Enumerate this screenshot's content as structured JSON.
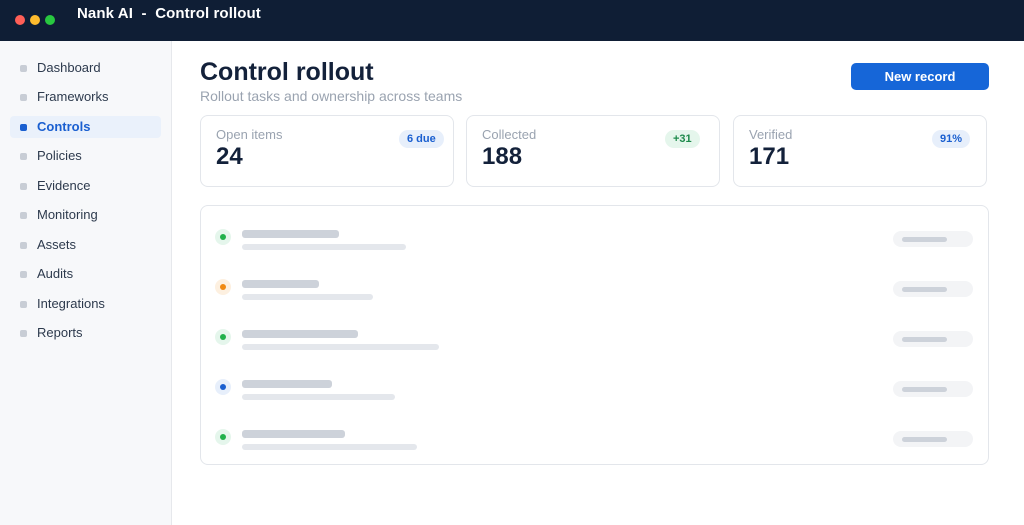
{
  "window": {
    "app_name": "Nank AI",
    "separator": "-",
    "page_name": "Control rollout"
  },
  "sidebar": {
    "items": [
      {
        "label": "Dashboard",
        "active": false
      },
      {
        "label": "Frameworks",
        "active": false
      },
      {
        "label": "Controls",
        "active": true
      },
      {
        "label": "Policies",
        "active": false
      },
      {
        "label": "Evidence",
        "active": false
      },
      {
        "label": "Monitoring",
        "active": false
      },
      {
        "label": "Assets",
        "active": false
      },
      {
        "label": "Audits",
        "active": false
      },
      {
        "label": "Integrations",
        "active": false
      },
      {
        "label": "Reports",
        "active": false
      }
    ]
  },
  "header": {
    "title": "Control rollout",
    "subtitle": "Rollout tasks and ownership across teams",
    "new_button_label": "New record"
  },
  "stats": [
    {
      "label": "Open items",
      "value": "24",
      "badge": "6 due",
      "badge_color": "#1a5fd0"
    },
    {
      "label": "Collected",
      "value": "188",
      "badge": "+31",
      "badge_color": "#1d8a4b"
    },
    {
      "label": "Verified",
      "value": "171",
      "badge": "91%",
      "badge_color": "#1a5fd0"
    }
  ],
  "list": {
    "rows": [
      {
        "status": "green",
        "status_color": "#22b14c"
      },
      {
        "status": "orange",
        "status_color": "#f08a14"
      },
      {
        "status": "green",
        "status_color": "#22b14c"
      },
      {
        "status": "blue",
        "status_color": "#1a5fd0"
      },
      {
        "status": "green",
        "status_color": "#22b14c"
      }
    ]
  }
}
